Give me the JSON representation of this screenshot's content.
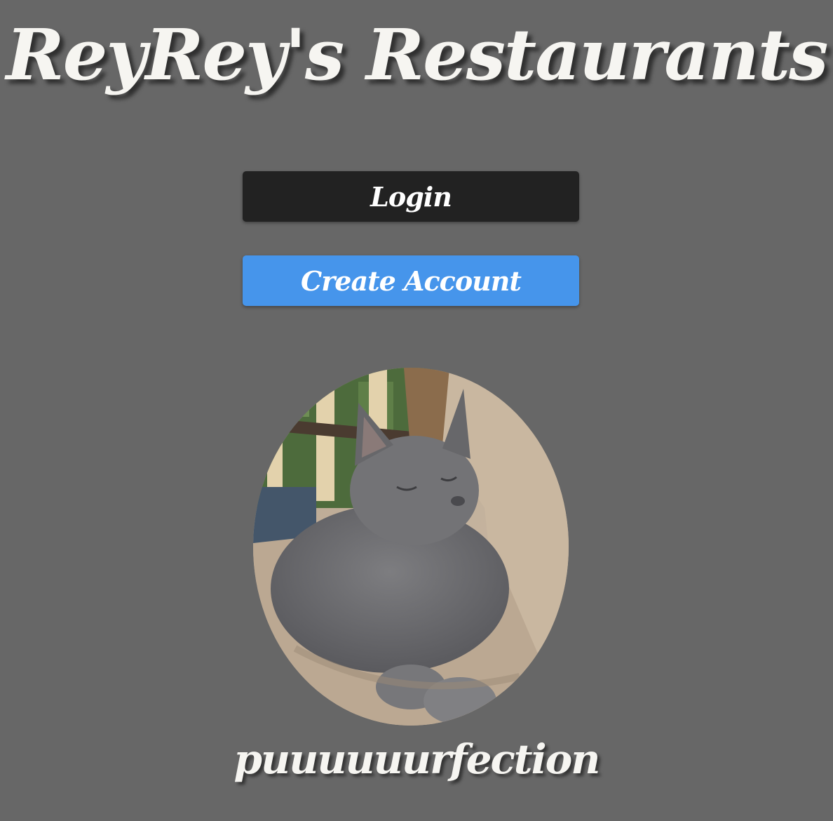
{
  "header": {
    "title": "ReyRey's Restaurants"
  },
  "actions": {
    "login_label": "Login",
    "create_account_label": "Create Account"
  },
  "hero": {
    "caption": "puuuuuurfection"
  },
  "colors": {
    "background": "#676767",
    "login_button": "#222222",
    "create_account_button": "#4695eb",
    "text": "#f6f5f1"
  }
}
